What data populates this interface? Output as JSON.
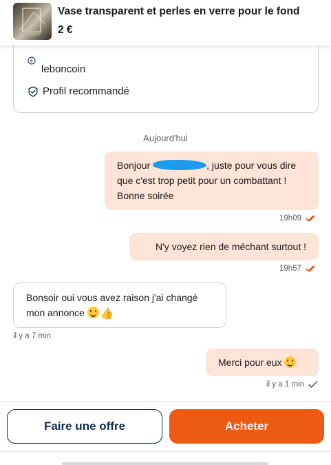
{
  "header": {
    "title": "Vase transparent et perles en verre pour le fond",
    "price": "2 €"
  },
  "profile_card": {
    "platform": "leboncoin",
    "recommended": "Profil recommandé"
  },
  "chat": {
    "date_separator": "Aujourd'hui",
    "messages": [
      {
        "direction": "outgoing",
        "greeting": "Bonjour",
        "text": ", juste pour vous dire que c'est trop petit pour un combattant ! Bonne soirée",
        "time": "19h09",
        "status": "read"
      },
      {
        "direction": "outgoing",
        "text": "N'y voyez rien de méchant surtout !",
        "time": "19h57",
        "status": "read"
      },
      {
        "direction": "incoming",
        "text": "Bonsoir oui vous avez raison j'ai changé mon annonce",
        "time": "il y a 7 min"
      },
      {
        "direction": "outgoing",
        "text": "Merci pour eux",
        "time": "il y a 1 min",
        "status": "sent"
      }
    ]
  },
  "actions": {
    "offer_label": "Faire une offre",
    "buy_label": "Acheter"
  },
  "colors": {
    "accent": "#ec5a13",
    "navy": "#0d2c54",
    "outgoing_bubble": "#fde3d8",
    "read_tick": "#ec5a13",
    "sent_tick": "#6b7280"
  },
  "icons": {
    "euro": "euro-icon",
    "recommended": "shield-check-icon",
    "read": "double-check-icon",
    "sent": "check-icon",
    "smile": "smile-emoji-icon",
    "thumbs_up": "thumbs-up-emoji-icon"
  }
}
